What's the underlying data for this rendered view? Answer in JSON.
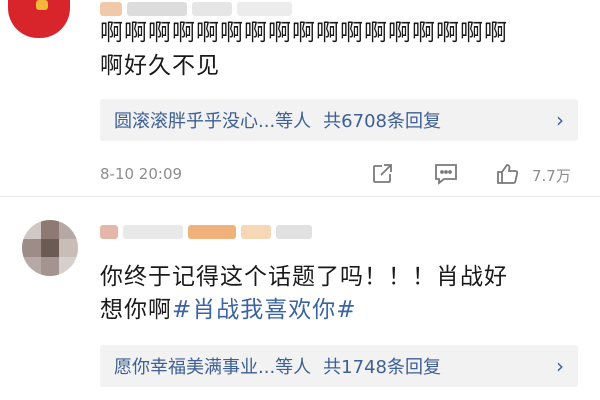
{
  "comments": [
    {
      "text": "啊啊啊啊啊啊啊啊啊啊啊啊啊啊啊啊啊\n啊好久不见",
      "replies": {
        "names": "圆滚滚胖乎乎没心...等人",
        "total": "共6708条回复",
        "chevron": "›"
      },
      "timestamp": "8-10 20:09",
      "likes": "7.7万"
    },
    {
      "text_plain": "你终于记得这个话题了吗！！！肖战好\n想你啊",
      "hashtag": "#肖战我喜欢你#",
      "replies": {
        "names": "愿你幸福美满事业...等人",
        "total": "共1748条回复",
        "chevron": "›"
      }
    }
  ],
  "colors": {
    "link": "#3d5f93",
    "reply_bg": "#f2f2f2",
    "avatar_red": "#d8242b",
    "meta_gray": "#8d8d8d"
  },
  "icons": {
    "share": "share-icon",
    "comment": "comment-icon",
    "like": "thumbs-up-icon"
  }
}
